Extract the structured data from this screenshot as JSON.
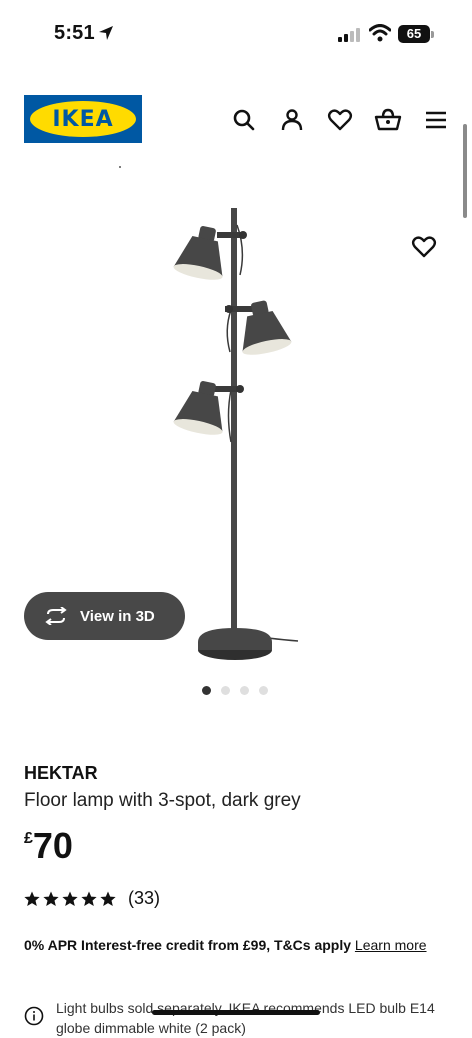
{
  "status_bar": {
    "time": "5:51",
    "battery": "65"
  },
  "header": {
    "logo_text": "IKEA",
    "icons": [
      "search-icon",
      "account-icon",
      "wishlist-heart-icon",
      "shopping-bag-icon",
      "menu-icon"
    ]
  },
  "gallery": {
    "view_3d_label": "View in 3D",
    "slide_count": 4,
    "active_slide": 1
  },
  "product": {
    "name": "HEKTAR",
    "description": "Floor lamp with 3-spot, dark grey",
    "currency": "£",
    "price": "70",
    "rating_stars": 5,
    "review_count": "(33)"
  },
  "finance": {
    "text": "0% APR Interest-free credit from £99, T&Cs apply",
    "link": "Learn more"
  },
  "note": {
    "text": "Light bulbs sold separately. IKEA recommends LED bulb E14 globe dimmable white (2 pack)"
  },
  "colors": {
    "ikea_blue": "#0058a3",
    "ikea_yellow": "#ffdb00",
    "lamp_grey": "#474747"
  }
}
